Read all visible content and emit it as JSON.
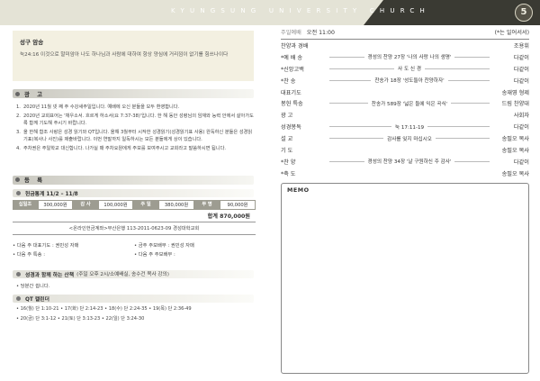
{
  "header": {
    "title": "KYUNGSUNG UNIVERSITY CHURCH",
    "logo": "5"
  },
  "verse": {
    "title": "성구 암송",
    "text": "눅24:16 이것으로 말미암아 나도 하나님과 사람에 대하여 항상 양심에 거리낌이 없기를 힘쓰나이다"
  },
  "notices": {
    "heading": "광 고",
    "items": [
      {
        "n": "1.",
        "text": "2020년 11월 넷 째 주 수강새주일입니다. 예배에 오신 분들을 모두 환영합니다."
      },
      {
        "n": "2.",
        "text": "2020년 교회표어는 '채우소서. 흐르게 하소서(요 7:37-38)'입니다. 한 해 동안 성령님의 임재와 능력 안에서 살아가도록 함께 기도해 주시기 바랍니다."
      },
      {
        "n": "3.",
        "text": "올 한해 함조 사랑은 성경 읽기와 QT입니다. 올해 3월부터 시작한 성경읽기(성경읽기표 사용) 완독하신 분들은 성경읽기표(복사나 사진)를 제출바랍니다. 이번 연말까지 일독하시는 모든 분들에게 상이 있습니다."
      },
      {
        "n": "4.",
        "text": "주차권은 주일학교 대신합니다. 나가실 때 주차요원에게 주보를 보여주시고 교회라고 말씀하시면 됩니다."
      }
    ]
  },
  "register": {
    "heading": "등 록"
  },
  "offering": {
    "heading": "헌금통계 11/2 – 11/8",
    "cells": [
      {
        "k": "십일조",
        "v": "300,000원"
      },
      {
        "k": "감 사",
        "v": "100,000원"
      },
      {
        "k": "주 일",
        "v": "380,000원"
      },
      {
        "k": "무 명",
        "v": "90,000원"
      }
    ],
    "total": "합계 870,000원",
    "account": "<온라인헌금계좌>부산은행 113-2011-0623-09 경성대학교회"
  },
  "duties": [
    "• 다음 주 대표기도 : 권민성 자매",
    "• 금주 주보배부 : 권민성 자매",
    "• 다음 주 특송 :",
    "• 다음 주 주보배부 :"
  ],
  "study": {
    "heading": "성경과 함께 하는 산책",
    "extra": "(주일 오후 2시/소예배실, 송수건 목사 강의)",
    "note": "• 당분간 쉽니다."
  },
  "qt": {
    "heading": "QT 캘린더",
    "line1": "• 16(월) 단 1:10-21 • 17(화) 단 2:14-23 • 18(수) 단 2:24-35 • 19(목) 단 2:36-49",
    "line2": "• 20(금) 단 3:1-12 • 21(토) 단 3:13-23 • 22(일) 단 3:24-30"
  },
  "worship": {
    "label": "주일예배",
    "time": "오전 11:00",
    "note": "(*는 일어서서)",
    "rows": [
      {
        "l": "찬양과 경배",
        "c": "",
        "r": "조용휘"
      },
      {
        "l": "*예 배 송",
        "c": "경성의 찬양 27장 '나의 사랑 나의 생명'",
        "r": "다같이"
      },
      {
        "l": "*신앙고백",
        "c": "사 도 신 경",
        "r": "다같이"
      },
      {
        "l": "*찬 송",
        "c": "찬송가 18장 '성도들아 찬양하자'",
        "r": "다같이"
      },
      {
        "l": "대표기도",
        "c": "",
        "r": "송재영 형제"
      },
      {
        "l": "봉헌 특송",
        "c": "찬송가 589장 '넓은 들에 익은 곡식'",
        "r": "드림 찬양대"
      },
      {
        "l": "광 고",
        "c": "",
        "r": "사회자"
      },
      {
        "l": "성경봉독",
        "c": "눅 17:11-19",
        "r": "다같이"
      },
      {
        "l": "설 교",
        "c": "감사를 잊지 마십시오",
        "r": "송필오 목사"
      },
      {
        "l": "기 도",
        "c": "",
        "r": "송필오 목사"
      },
      {
        "l": "*찬 양",
        "c": "경성의 찬양 34장 '날 구원하신 주 감사'",
        "r": "다같이"
      },
      {
        "l": "*축 도",
        "c": "",
        "r": "송필오 목사"
      }
    ]
  },
  "memo": {
    "label": "MEMO"
  }
}
